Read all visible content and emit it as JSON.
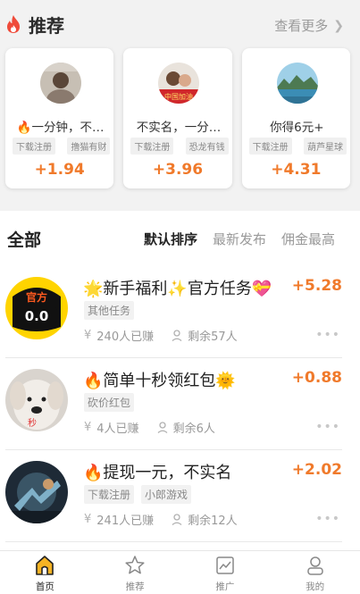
{
  "colors": {
    "accent": "#f07a2b",
    "nav_active": "#f5b324"
  },
  "recommend": {
    "title": "推荐",
    "more_label": "查看更多",
    "cards": [
      {
        "title": "🔥一分钟，不…",
        "tags": [
          "下载注册",
          "撸猫有财"
        ],
        "money": "+1.94",
        "avatar_text": ""
      },
      {
        "title": "不实名，一分…",
        "tags": [
          "下载注册",
          "恐龙有钱"
        ],
        "money": "+3.96",
        "avatar_text": "中国加油"
      },
      {
        "title": "你得6元+",
        "tags": [
          "下载注册",
          "葫芦星球"
        ],
        "money": "+4.31",
        "avatar_text": ""
      }
    ]
  },
  "all": {
    "title": "全部",
    "sort_tabs": [
      "默认排序",
      "最新发布",
      "佣金最高"
    ],
    "items": [
      {
        "title": "🌟新手福利✨官方任务💝",
        "tags": [
          "其他任务"
        ],
        "money": "+5.28",
        "earned": "240人已赚",
        "remaining": "剩余57人",
        "avatar_text": "官方"
      },
      {
        "title": "🔥简单十秒领红包🌞",
        "tags": [
          "砍价红包"
        ],
        "money": "+0.88",
        "earned": "4人已赚",
        "remaining": "剩余6人",
        "avatar_text": ""
      },
      {
        "title": "🔥提现一元，不实名",
        "tags": [
          "下载注册",
          "小郎游戏"
        ],
        "money": "+2.02",
        "earned": "241人已赚",
        "remaining": "剩余12人",
        "avatar_text": ""
      }
    ]
  },
  "nav": {
    "items": [
      {
        "label": "首页",
        "icon": "home-icon",
        "active": true
      },
      {
        "label": "推荐",
        "icon": "star-icon",
        "active": false
      },
      {
        "label": "推广",
        "icon": "chart-icon",
        "active": false
      },
      {
        "label": "我的",
        "icon": "user-icon",
        "active": false
      }
    ]
  },
  "icons": {
    "earned": "yen-icon",
    "remaining": "person-icon",
    "more": "more-dots-icon",
    "flame": "flame-icon"
  }
}
